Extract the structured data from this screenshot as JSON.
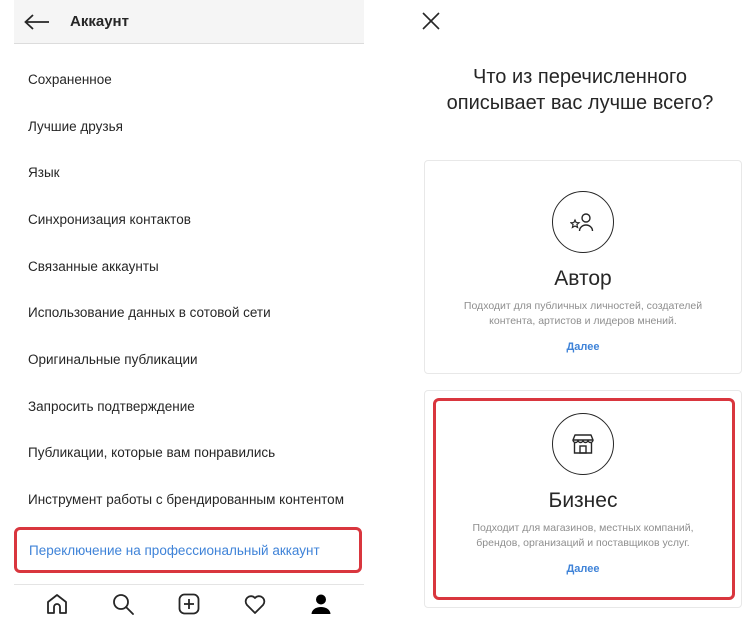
{
  "left": {
    "header": {
      "title": "Аккаунт"
    },
    "menu": [
      "Сохраненное",
      "Лучшие друзья",
      "Язык",
      "Синхронизация контактов",
      "Связанные аккаунты",
      "Использование данных в сотовой сети",
      "Оригинальные публикации",
      "Запросить подтверждение",
      "Публикации, которые вам понравились",
      "Инструмент работы с брендированным контентом"
    ],
    "highlighted_item": "Переключение на профессиональный аккаунт",
    "tabbar": [
      "home-icon",
      "search-icon",
      "add-post-icon",
      "heart-icon",
      "profile-icon"
    ]
  },
  "right": {
    "question_line1": "Что из перечисленного",
    "question_line2": "описывает вас лучше всего?",
    "cards": [
      {
        "title": "Автор",
        "desc_line1": "Подходит для публичных личностей, создателей",
        "desc_line2": "контента, артистов и лидеров мнений.",
        "link": "Далее",
        "icon": "creator-icon"
      },
      {
        "title": "Бизнес",
        "desc_line1": "Подходит для магазинов, местных компаний,",
        "desc_line2": "брендов, организаций и поставщиков услуг.",
        "link": "Далее",
        "icon": "shop-icon"
      }
    ]
  },
  "colors": {
    "highlight_border": "#d9363e",
    "link_blue": "#3f83d8",
    "text": "#262626",
    "secondary_text": "#8e8e8e"
  }
}
